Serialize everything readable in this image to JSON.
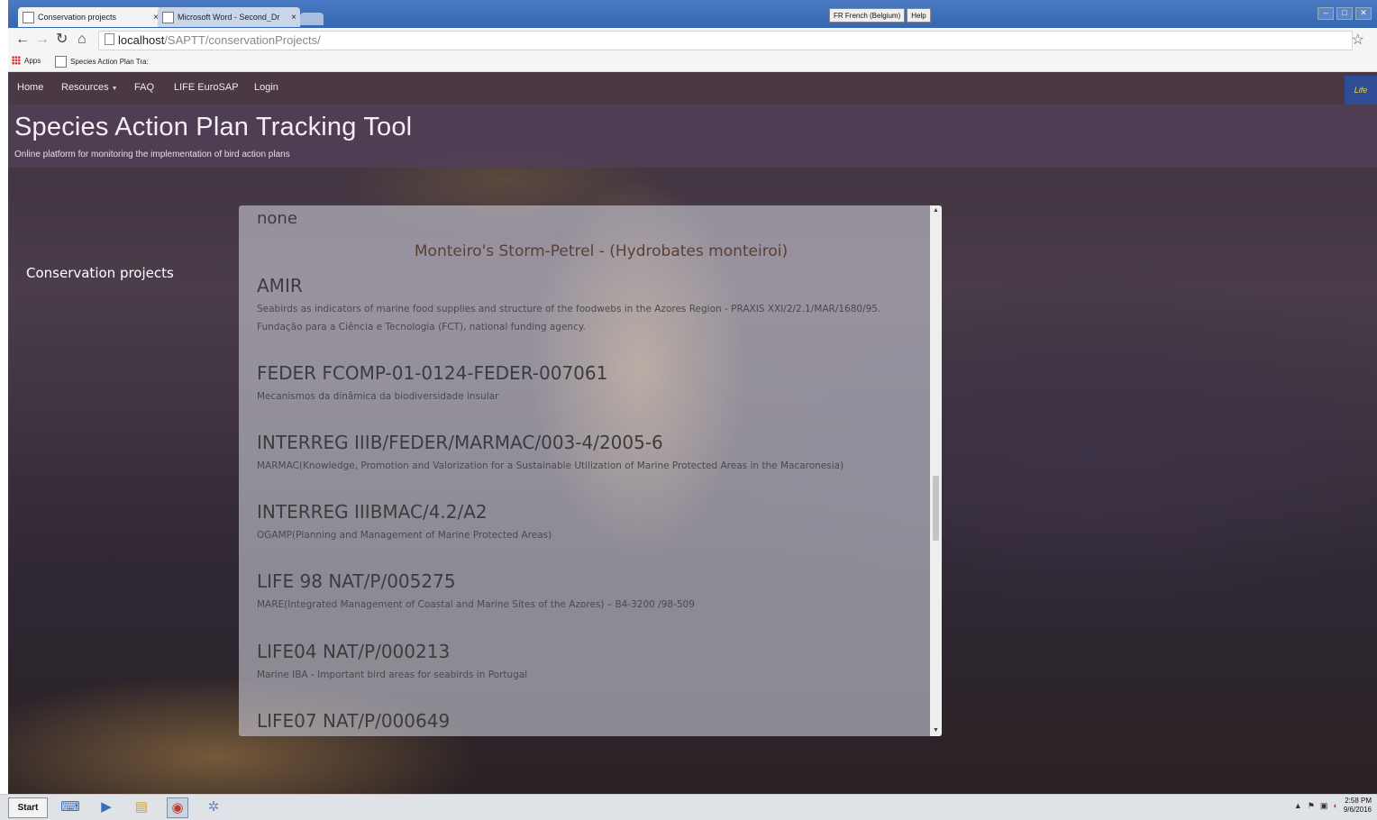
{
  "browser": {
    "tabs": [
      {
        "title": "Conservation projects",
        "close": "×"
      },
      {
        "title": "Microsoft Word - Second_Dr",
        "close": "×"
      }
    ],
    "ime": [
      "FR French (Belgium)",
      "Help"
    ],
    "window_controls": [
      "–",
      "□",
      "✕"
    ],
    "url_host": "localhost",
    "url_path": "/SAPTT/conservationProjects/",
    "bookmarks": [
      "Apps",
      "Species Action Plan Tra:"
    ]
  },
  "site": {
    "nav": [
      "Home",
      "Resources",
      "FAQ",
      "LIFE EuroSAP",
      "Login"
    ],
    "logo_text": "Life",
    "title": "Species Action Plan Tracking Tool",
    "subtitle": "Online platform for monitoring the implementation of bird action plans",
    "sidebar_link": "Conservation projects"
  },
  "panel": {
    "none_text": "none",
    "species_heading": "Monteiro's Storm-Petrel - (Hydrobates monteiroi)",
    "projects": [
      {
        "code": "AMIR",
        "desc": "Seabirds as indicators of marine food supplies and structure of the foodwebs in the Azores Region - PRAXIS XXI/2/2.1/MAR/1680/95. Fundação para a Ciência e Tecnologia (FCT), national funding agency."
      },
      {
        "code": "FEDER FCOMP-01-0124-FEDER-007061",
        "desc": "Mecanismos da dinâmica da biodiversidade insular"
      },
      {
        "code": "INTERREG IIIB/FEDER/MARMAC/003-4/2005-6",
        "desc": "MARMAC(Knowledge, Promotion and Valorization for a Sustainable Utilization of Marine Protected Areas in the Macaronesia)"
      },
      {
        "code": "INTERREG IIIBMAC/4.2/A2",
        "desc": "OGAMP(Planning and Management of Marine Protected Areas)"
      },
      {
        "code": "LIFE 98 NAT/P/005275",
        "desc": "MARE(Integrated Management of Coastal and Marine Sites of the Azores) – B4-3200 /98-509"
      },
      {
        "code": "LIFE04 NAT/P/000213",
        "desc": "Marine IBA - Important bird areas for seabirds in Portugal"
      },
      {
        "code": "LIFE07 NAT/P/000649",
        "desc": ""
      }
    ]
  },
  "taskbar": {
    "start": "Start",
    "time": "2:58 PM",
    "date": "9/6/2016"
  }
}
